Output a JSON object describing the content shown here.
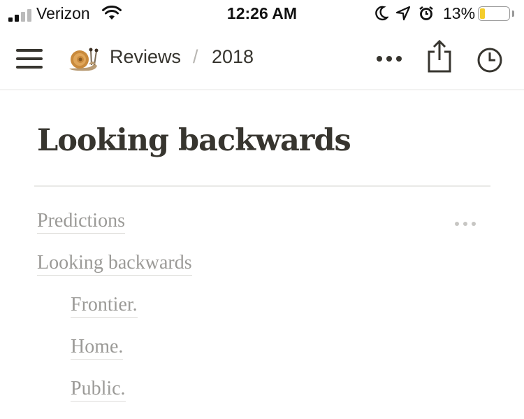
{
  "status_bar": {
    "carrier": "Verizon",
    "time": "12:26 AM",
    "battery_percent": "13%",
    "battery_level": 0.13,
    "signal_bars_filled": 2,
    "signal_bars_total": 4
  },
  "nav": {
    "workspace_icon": "snail-emoji",
    "breadcrumb": [
      "Reviews",
      "2018"
    ],
    "breadcrumb_separator": "/"
  },
  "page": {
    "title": "Looking backwards",
    "links": [
      {
        "label": "Predictions",
        "level": 0
      },
      {
        "label": "Looking backwards",
        "level": 0
      },
      {
        "label": "Frontier.",
        "level": 1
      },
      {
        "label": "Home.",
        "level": 1
      },
      {
        "label": "Public.",
        "level": 1
      }
    ]
  },
  "colors": {
    "text": "#37352f",
    "link": "#9b9a97",
    "battery_low": "#f4cd2c"
  }
}
